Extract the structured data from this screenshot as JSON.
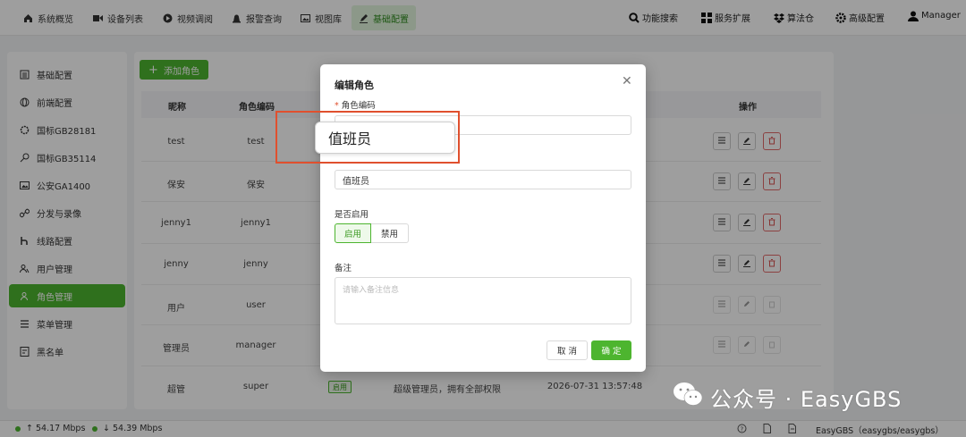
{
  "topnav": {
    "items": [
      "系统概览",
      "设备列表",
      "视频调阅",
      "报警查询",
      "视图库",
      "基础配置"
    ],
    "right": [
      "功能搜索",
      "服务扩展",
      "算法仓",
      "高级配置",
      "Manager"
    ]
  },
  "sidebar": {
    "items": [
      "基础配置",
      "前端配置",
      "国标GB28181",
      "国标GB35114",
      "公安GA1400",
      "分发与录像",
      "线路配置",
      "用户管理",
      "角色管理",
      "菜单管理",
      "黑名单"
    ],
    "active": "角色管理"
  },
  "toolbar": {
    "add_label": "添加角色"
  },
  "table": {
    "headers": {
      "nickname": "昵称",
      "code": "角色编码",
      "ops": "操作"
    },
    "rows": [
      {
        "nickname": "test",
        "code": "test"
      },
      {
        "nickname": "保安",
        "code": "保安"
      },
      {
        "nickname": "jenny1",
        "code": "jenny1"
      },
      {
        "nickname": "jenny",
        "code": "jenny"
      },
      {
        "nickname": "用户",
        "code": "user"
      },
      {
        "nickname": "管理员",
        "code": "manager"
      },
      {
        "nickname": "超管",
        "code": "super",
        "status": "启用",
        "remark": "超级管理员，拥有全部权限",
        "time": "2026-07-31 13:57:48"
      }
    ]
  },
  "modal": {
    "title": "编辑角色",
    "code_label": "角色编码",
    "code_value": "值班员",
    "name_value": "值班员",
    "enable_label": "是否启用",
    "enable_on": "启用",
    "enable_off": "禁用",
    "remark_label": "备注",
    "remark_placeholder": "请输入备注信息",
    "cancel": "取 消",
    "confirm": "确 定"
  },
  "statusbar": {
    "up": "↑ 54.17 Mbps",
    "down": "↓ 54.39 Mbps",
    "brand": "EasyGBS（easygbs/easygbs）"
  },
  "watermark": "公众号 · EasyGBS",
  "colors": {
    "accent": "#4db52f",
    "danger": "#e26a6a",
    "highlight": "#e0502e"
  }
}
